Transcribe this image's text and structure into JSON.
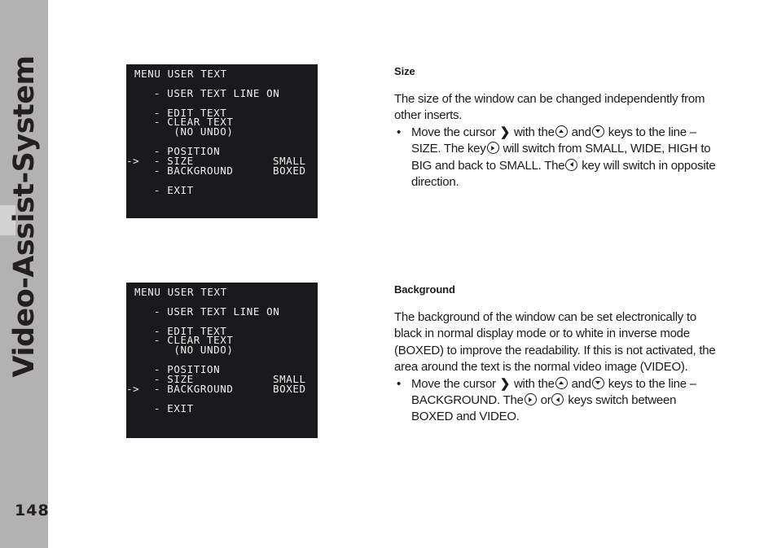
{
  "sidebar": {
    "title": "Video-Assist-System",
    "page_number": "148",
    "tab_color": "#d2d2d2",
    "bg_color": "#b2b2b2"
  },
  "osd_screens": [
    {
      "name": "size-menu",
      "title": "MENU USER TEXT",
      "bg_color": "#1a1a1c",
      "text_color": "#f2f2f2",
      "cursor_glyph": "->",
      "selected_item": "SIZE",
      "lines": [
        {
          "cursor": "",
          "label": "MENU USER TEXT",
          "value": "",
          "indent": false
        },
        {
          "cursor": "",
          "label": "",
          "value": "",
          "indent": false
        },
        {
          "cursor": "",
          "label": "- USER TEXT LINE ON",
          "value": "",
          "indent": true
        },
        {
          "cursor": "",
          "label": "",
          "value": "",
          "indent": false
        },
        {
          "cursor": "",
          "label": "- EDIT TEXT",
          "value": "",
          "indent": true
        },
        {
          "cursor": "",
          "label": "- CLEAR TEXT",
          "value": "",
          "indent": true
        },
        {
          "cursor": "",
          "label": "   (NO UNDO)",
          "value": "",
          "indent": true
        },
        {
          "cursor": "",
          "label": "",
          "value": "",
          "indent": false
        },
        {
          "cursor": "",
          "label": "- POSITION",
          "value": "",
          "indent": true
        },
        {
          "cursor": "->",
          "label": "- SIZE",
          "value": "SMALL",
          "indent": true
        },
        {
          "cursor": "",
          "label": "- BACKGROUND",
          "value": "BOXED",
          "indent": true
        },
        {
          "cursor": "",
          "label": "",
          "value": "",
          "indent": false
        },
        {
          "cursor": "",
          "label": "- EXIT",
          "value": "",
          "indent": true
        }
      ]
    },
    {
      "name": "background-menu",
      "title": "MENU USER TEXT",
      "bg_color": "#1a1a1c",
      "text_color": "#f2f2f2",
      "cursor_glyph": "->",
      "selected_item": "BACKGROUND",
      "lines": [
        {
          "cursor": "",
          "label": "MENU USER TEXT",
          "value": "",
          "indent": false
        },
        {
          "cursor": "",
          "label": "",
          "value": "",
          "indent": false
        },
        {
          "cursor": "",
          "label": "- USER TEXT LINE ON",
          "value": "",
          "indent": true
        },
        {
          "cursor": "",
          "label": "",
          "value": "",
          "indent": false
        },
        {
          "cursor": "",
          "label": "- EDIT TEXT",
          "value": "",
          "indent": true
        },
        {
          "cursor": "",
          "label": "- CLEAR TEXT",
          "value": "",
          "indent": true
        },
        {
          "cursor": "",
          "label": "   (NO UNDO)",
          "value": "",
          "indent": true
        },
        {
          "cursor": "",
          "label": "",
          "value": "",
          "indent": false
        },
        {
          "cursor": "",
          "label": "- POSITION",
          "value": "",
          "indent": true
        },
        {
          "cursor": "",
          "label": "- SIZE",
          "value": "SMALL",
          "indent": true
        },
        {
          "cursor": "->",
          "label": "- BACKGROUND",
          "value": "BOXED",
          "indent": true
        },
        {
          "cursor": "",
          "label": "",
          "value": "",
          "indent": false
        },
        {
          "cursor": "",
          "label": "- EXIT",
          "value": "",
          "indent": true
        }
      ]
    }
  ],
  "sections": {
    "size": {
      "heading": "Size",
      "paragraph": "The size of the window can be changed independently from other inserts.",
      "bullet_dot": "•",
      "bullet": {
        "part1": "Move the cursor",
        "cursor_glyph": "❯",
        "part2": "with the",
        "part3": "and",
        "part4": "keys to the line – SIZE. The key",
        "part5": "will switch from SMALL, WIDE, HIGH to BIG and back to SMALL. The",
        "part6": "key will switch in opposite direction."
      }
    },
    "background": {
      "heading": "Background",
      "paragraph": "The background of the window can be set electronically to black in normal display mode or to white in inverse mode (BOXED) to improve the readability. If this is not activated, the area around the text is the normal video image (VIDEO).",
      "bullet_dot": "•",
      "bullet": {
        "part1": "Move the cursor",
        "cursor_glyph": "❯",
        "part2": "with the",
        "part3": "and",
        "part4": "keys to the line – BACKGROUND. The",
        "part5": "or",
        "part6": "keys switch between BOXED and VIDEO."
      }
    }
  },
  "icons": {
    "up_key": "circled-up-arrow",
    "down_key": "circled-down-arrow",
    "right_key": "circled-right-arrow",
    "left_key": "circled-left-arrow"
  }
}
